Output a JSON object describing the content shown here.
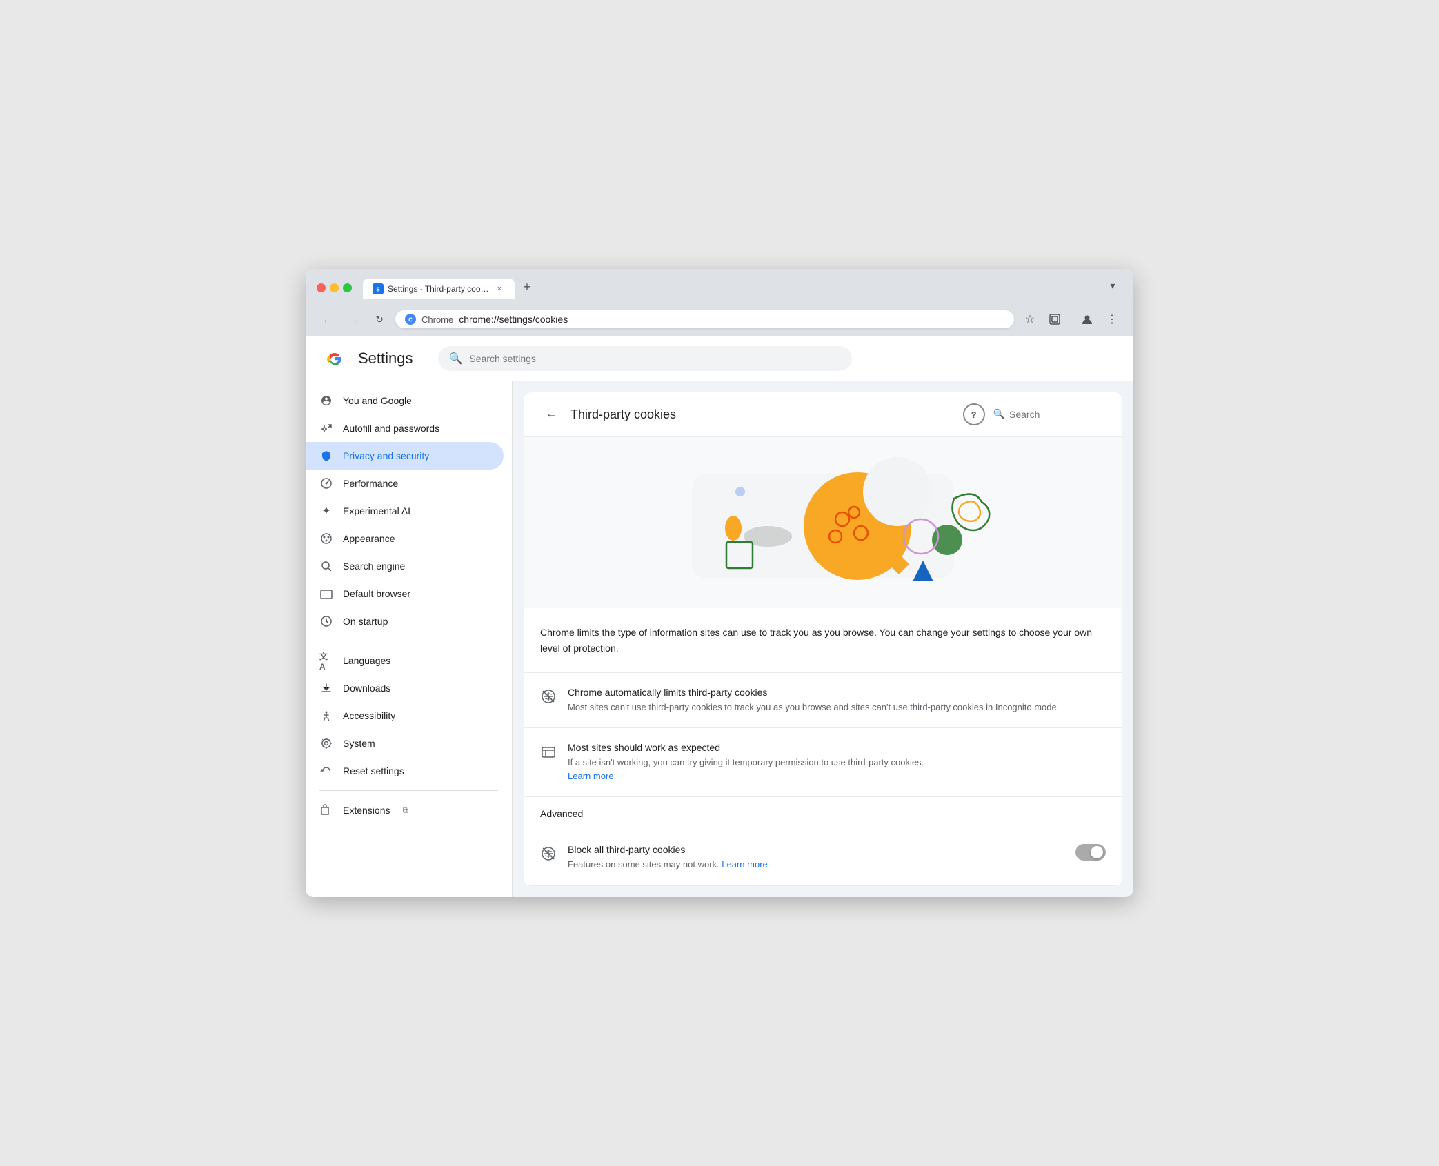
{
  "browser": {
    "tab_title": "Settings - Third-party cookie",
    "tab_close_label": "×",
    "new_tab_label": "+",
    "dropdown_label": "▾",
    "back_label": "←",
    "forward_label": "→",
    "reload_label": "↻",
    "address_site": "Chrome",
    "address_url": "chrome://settings/cookies",
    "star_label": "☆",
    "extension_label": "⬚",
    "profile_label": "👤",
    "menu_label": "⋮"
  },
  "settings": {
    "title": "Settings",
    "search_placeholder": "Search settings"
  },
  "sidebar": {
    "items": [
      {
        "id": "you-and-google",
        "label": "You and Google",
        "icon": "G"
      },
      {
        "id": "autofill",
        "label": "Autofill and passwords",
        "icon": "🔑"
      },
      {
        "id": "privacy",
        "label": "Privacy and security",
        "icon": "🛡"
      },
      {
        "id": "performance",
        "label": "Performance",
        "icon": "⏱"
      },
      {
        "id": "experimental-ai",
        "label": "Experimental AI",
        "icon": "✦"
      },
      {
        "id": "appearance",
        "label": "Appearance",
        "icon": "🎨"
      },
      {
        "id": "search-engine",
        "label": "Search engine",
        "icon": "🔍"
      },
      {
        "id": "default-browser",
        "label": "Default browser",
        "icon": "⬜"
      },
      {
        "id": "on-startup",
        "label": "On startup",
        "icon": "⏻"
      }
    ],
    "items2": [
      {
        "id": "languages",
        "label": "Languages",
        "icon": "文A"
      },
      {
        "id": "downloads",
        "label": "Downloads",
        "icon": "⬇"
      },
      {
        "id": "accessibility",
        "label": "Accessibility",
        "icon": "♿"
      },
      {
        "id": "system",
        "label": "System",
        "icon": "🔧"
      },
      {
        "id": "reset",
        "label": "Reset settings",
        "icon": "↺"
      }
    ],
    "items3": [
      {
        "id": "extensions",
        "label": "Extensions",
        "icon": "⬚",
        "external": true
      }
    ]
  },
  "content": {
    "back_label": "←",
    "title": "Third-party cookies",
    "help_label": "?",
    "search_placeholder": "Search",
    "description": "Chrome limits the type of information sites can use to track you as you browse. You can change your settings to choose your own level of protection.",
    "options": [
      {
        "id": "auto-limit",
        "title": "Chrome automatically limits third-party cookies",
        "desc": "Most sites can't use third-party cookies to track you as you browse and sites can't use third-party cookies in Incognito mode.",
        "learn_more": null
      },
      {
        "id": "most-sites",
        "title": "Most sites should work as expected",
        "desc": "If a site isn't working, you can try giving it temporary permission to use third-party cookies.",
        "learn_more": "Learn more"
      }
    ],
    "advanced_label": "Advanced",
    "block_all": {
      "title": "Block all third-party cookies",
      "desc": "Features on some sites may not work.",
      "learn_more": "Learn more",
      "toggle_state": "off"
    }
  }
}
